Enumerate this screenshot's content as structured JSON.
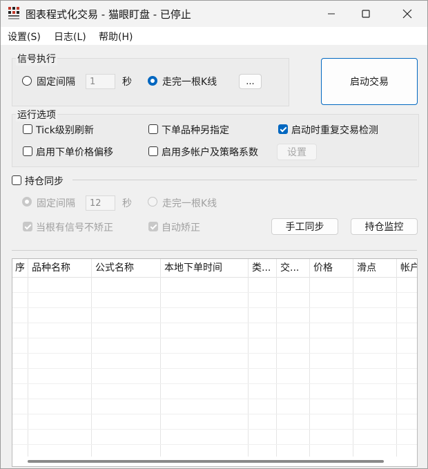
{
  "window": {
    "title": "图表程式化交易 - 猫眼盯盘 - 已停止",
    "minimize_icon": "minimize-icon",
    "maximize_icon": "maximize-icon",
    "close_icon": "close-icon"
  },
  "menu": {
    "settings": "设置(S)",
    "log": "日志(L)",
    "help": "帮助(H)"
  },
  "signal": {
    "group_label": "信号执行",
    "fixed_interval_label": "固定间隔",
    "interval_value": "1",
    "seconds_unit": "秒",
    "full_bar_label": "走完一根K线",
    "more_button": "...",
    "selected": "full_bar"
  },
  "start_trade_button": "启动交易",
  "run_options": {
    "group_label": "运行选项",
    "tick_refresh": {
      "label": "Tick级别刷新",
      "checked": false
    },
    "separate_order_symbol": {
      "label": "下单品种另指定",
      "checked": false
    },
    "repeat_check_on_start": {
      "label": "启动时重复交易检测",
      "checked": true
    },
    "price_offset": {
      "label": "启用下单价格偏移",
      "checked": false
    },
    "multi_account": {
      "label": "启用多帐户及策略系数",
      "checked": false
    },
    "settings_button": "设置"
  },
  "position_sync": {
    "label": "持仓同步",
    "checked": false,
    "fixed_interval_label": "固定间隔",
    "interval_value": "12",
    "seconds_unit": "秒",
    "full_bar_label": "走完一根K线",
    "no_correct_on_signal": {
      "label": "当根有信号不矫正",
      "checked": true
    },
    "auto_correct": {
      "label": "自动矫正",
      "checked": true
    },
    "manual_sync_button": "手工同步",
    "monitor_button": "持仓监控"
  },
  "table": {
    "columns": [
      "序",
      "品种名称",
      "公式名称",
      "本地下单时间",
      "类...",
      "交...",
      "价格",
      "滑点",
      "帐户"
    ]
  },
  "colors": {
    "accent": "#0067c0",
    "background": "#f0f0f0"
  }
}
